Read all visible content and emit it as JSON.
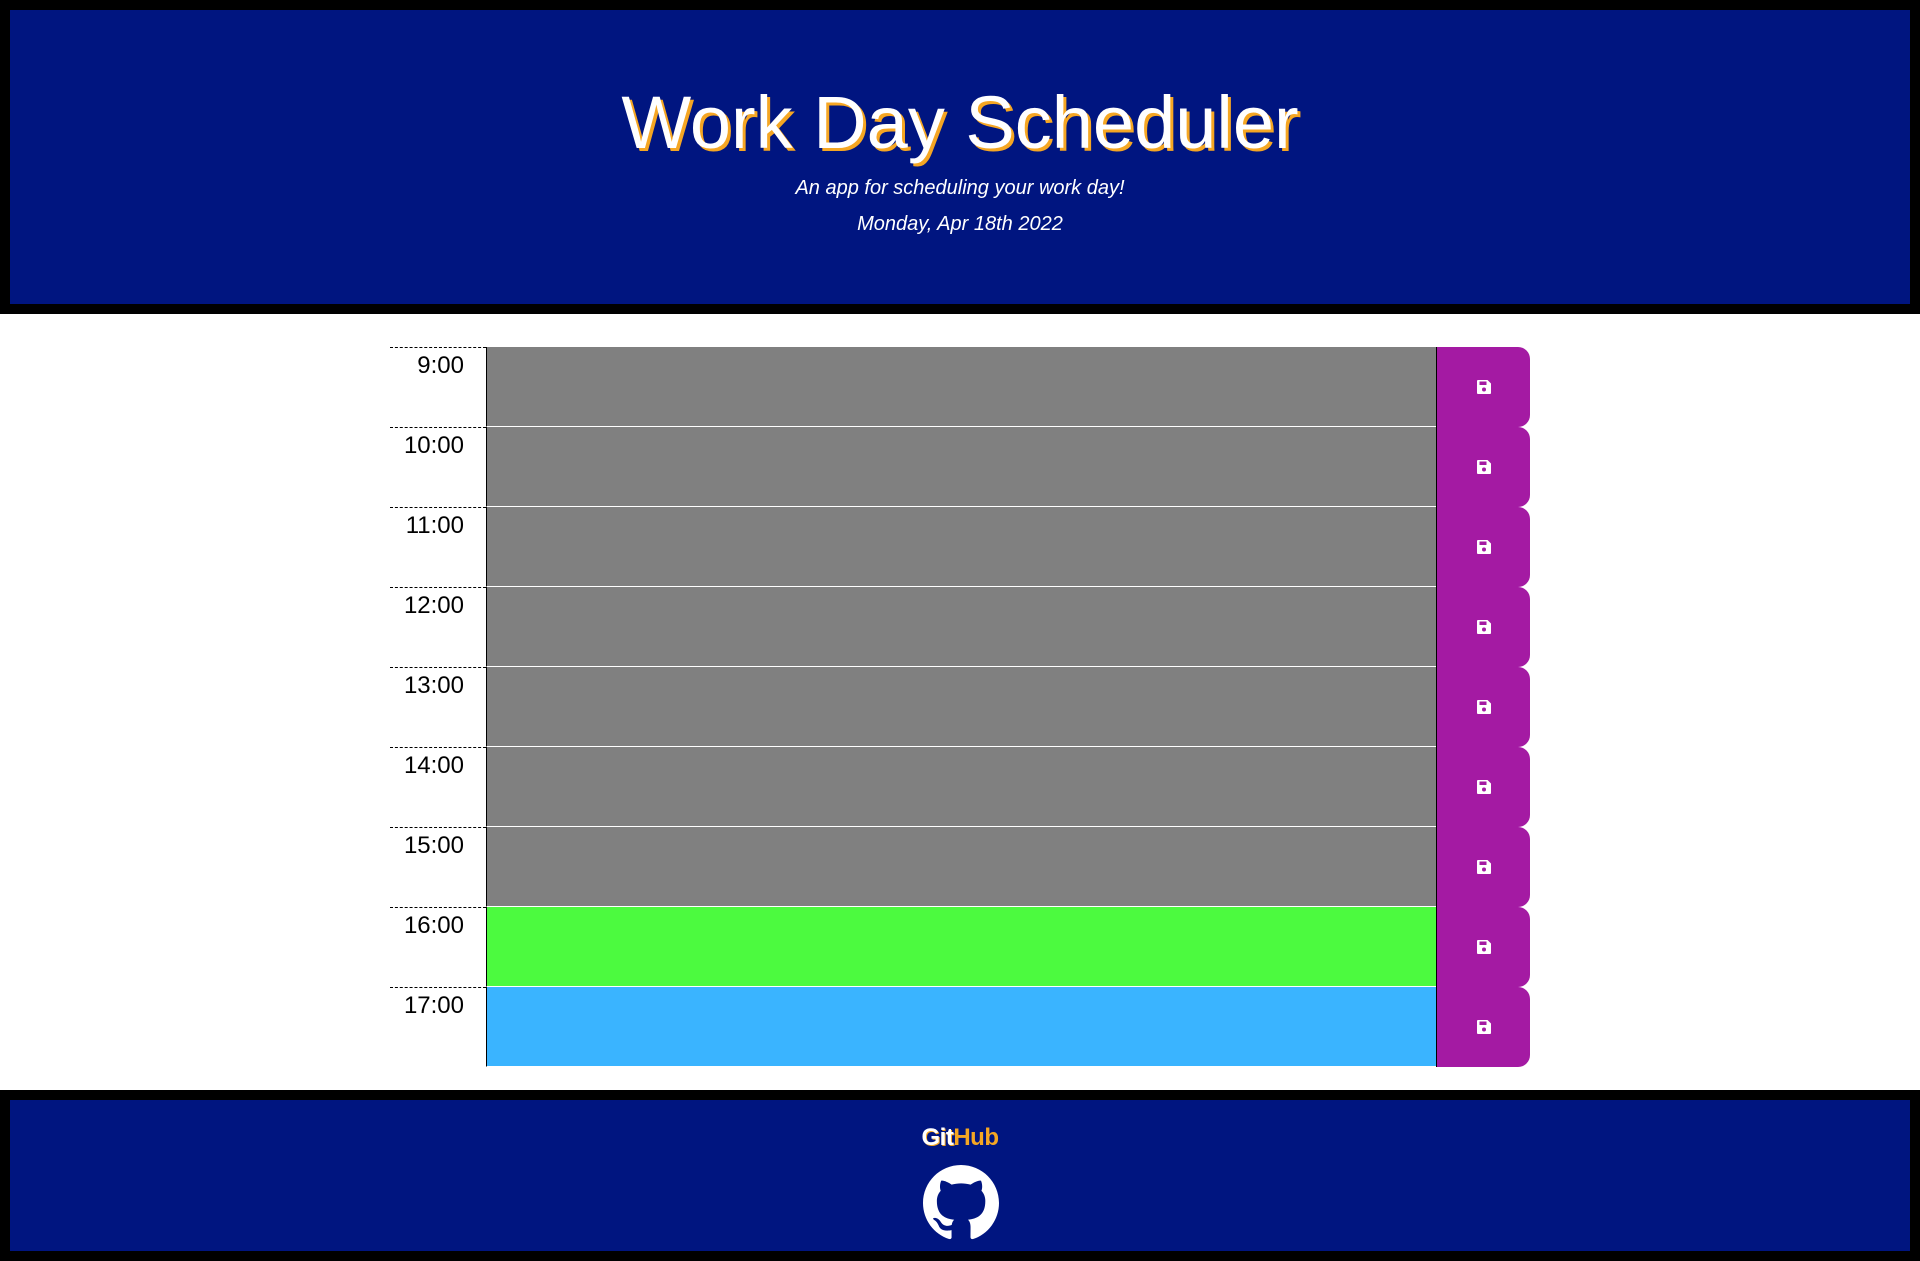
{
  "header": {
    "title": "Work Day Scheduler",
    "subtitle": "An app for scheduling your work day!",
    "date": "Monday, Apr 18th 2022"
  },
  "schedule": {
    "rows": [
      {
        "hour": "9:00",
        "status": "past",
        "text": ""
      },
      {
        "hour": "10:00",
        "status": "past",
        "text": ""
      },
      {
        "hour": "11:00",
        "status": "past",
        "text": ""
      },
      {
        "hour": "12:00",
        "status": "past",
        "text": ""
      },
      {
        "hour": "13:00",
        "status": "past",
        "text": ""
      },
      {
        "hour": "14:00",
        "status": "past",
        "text": ""
      },
      {
        "hour": "15:00",
        "status": "past",
        "text": ""
      },
      {
        "hour": "16:00",
        "status": "present",
        "text": ""
      },
      {
        "hour": "17:00",
        "status": "future",
        "text": ""
      }
    ],
    "save_icon": "floppy-disk-icon"
  },
  "footer": {
    "link_part1": "Git",
    "link_part2": "Hub",
    "logo_icon": "github-icon"
  },
  "colors": {
    "header_bg": "#001580",
    "past": "#808080",
    "present": "#4cfa3f",
    "future": "#3ab4ff",
    "save_button": "#a41aa3",
    "accent": "#f5a623"
  }
}
